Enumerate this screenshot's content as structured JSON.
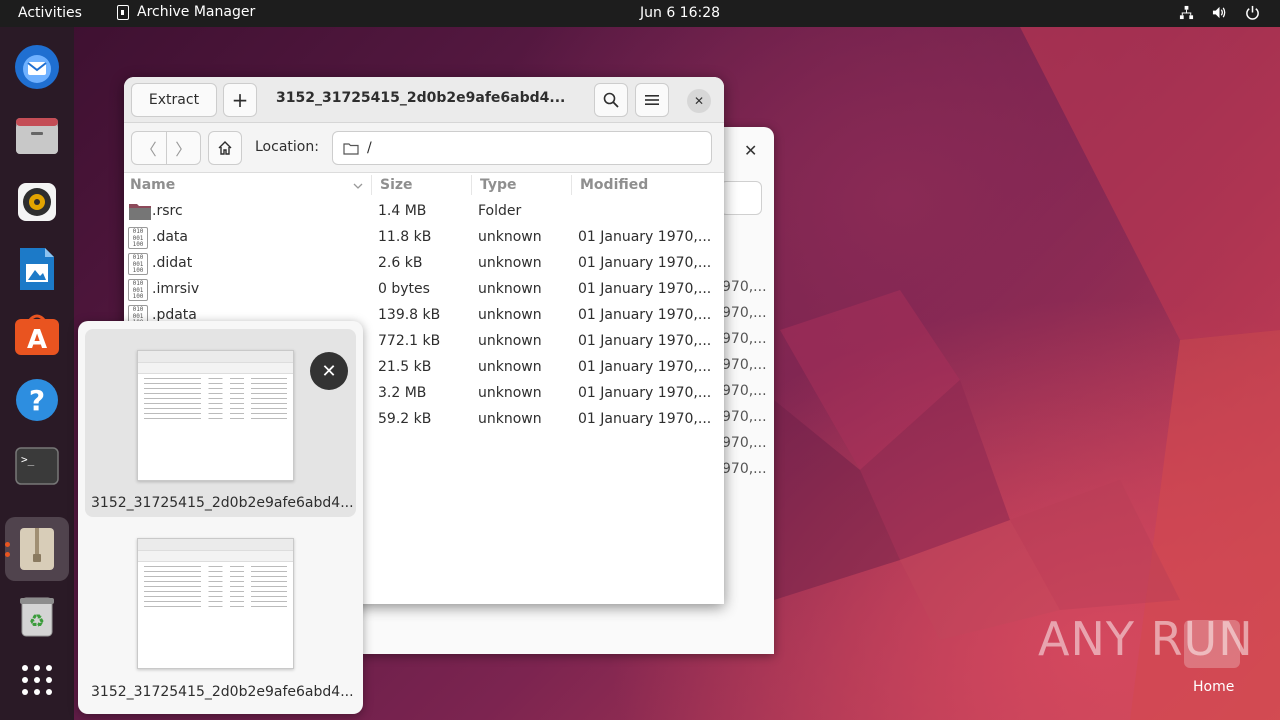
{
  "topbar": {
    "activities": "Activities",
    "app_name": "Archive Manager",
    "datetime": "Jun 6  16:28"
  },
  "dock": {
    "items": [
      "thunderbird-icon",
      "files-icon",
      "rhythmbox-icon",
      "writer-icon",
      "app-center-icon",
      "help-icon",
      "terminal-icon",
      "archive-manager-icon",
      "trash-icon",
      "show-apps-icon"
    ]
  },
  "window": {
    "extract_label": "Extract",
    "add_label": "+",
    "title": "3152_31725415_2d0b2e9afe6abd4...",
    "location_label": "Location:",
    "location_value": "/",
    "columns": [
      "Name",
      "Size",
      "Type",
      "Modified"
    ],
    "rows": [
      {
        "name": ".rsrc",
        "size": "1.4 MB",
        "type": "Folder",
        "modified": "",
        "kind": "folder"
      },
      {
        "name": ".data",
        "size": "11.8 kB",
        "type": "unknown",
        "modified": "01 January 1970,...",
        "kind": "binary"
      },
      {
        "name": ".didat",
        "size": "2.6 kB",
        "type": "unknown",
        "modified": "01 January 1970,...",
        "kind": "binary"
      },
      {
        "name": ".imrsiv",
        "size": "0 bytes",
        "type": "unknown",
        "modified": "01 January 1970,...",
        "kind": "binary"
      },
      {
        "name": ".pdata",
        "size": "139.8 kB",
        "type": "unknown",
        "modified": "01 January 1970,...",
        "kind": "binary"
      },
      {
        "name": "",
        "size": "772.1 kB",
        "type": "unknown",
        "modified": "01 January 1970,...",
        "kind": "hidden"
      },
      {
        "name": "",
        "size": "21.5 kB",
        "type": "unknown",
        "modified": "01 January 1970,...",
        "kind": "hidden"
      },
      {
        "name": "",
        "size": "3.2 MB",
        "type": "unknown",
        "modified": "01 January 1970,...",
        "kind": "hidden"
      },
      {
        "name": "",
        "size": "59.2 kB",
        "type": "unknown",
        "modified": "01 January 1970,...",
        "kind": "hidden"
      }
    ]
  },
  "background_window": {
    "rows": [
      "970,...",
      "970,...",
      "970,...",
      "970,...",
      "970,...",
      "970,...",
      "970,...",
      "970,..."
    ]
  },
  "switcher": {
    "items": [
      {
        "label": "3152_31725415_2d0b2e9afe6abd4..."
      },
      {
        "label": "3152_31725415_2d0b2e9afe6abd4..."
      }
    ]
  },
  "watermark": {
    "text": "ANY RUN",
    "home_label": "Home"
  },
  "colors": {
    "topbar": "#1d1d1d",
    "accent": "#e95420",
    "folder": "#8c4a5a"
  }
}
